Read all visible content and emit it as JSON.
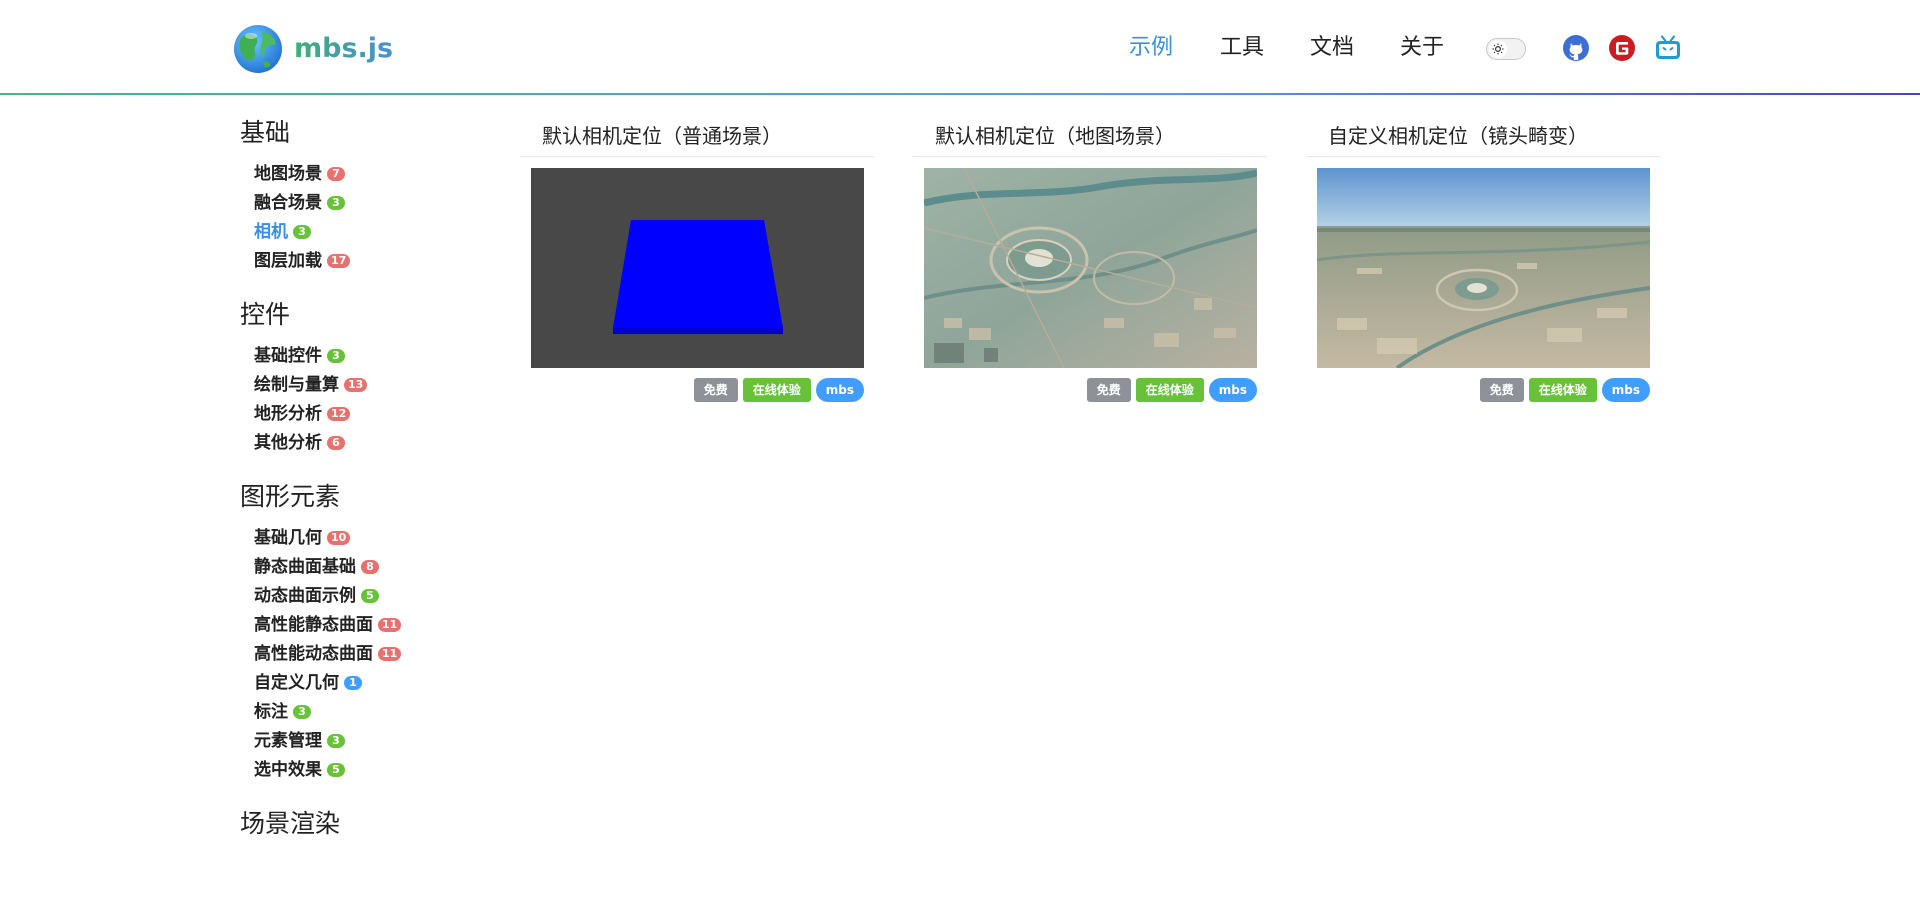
{
  "header": {
    "logo_text": "mbs.js",
    "nav": [
      {
        "label": "示例",
        "active": true
      },
      {
        "label": "工具",
        "active": false
      },
      {
        "label": "文档",
        "active": false
      },
      {
        "label": "关于",
        "active": false
      }
    ],
    "icons": [
      "sun-icon",
      "github-icon",
      "gitee-icon",
      "bilibili-icon"
    ],
    "colors": {
      "accent": "#3a8fe0",
      "brand_green": "#3fae74"
    }
  },
  "sidebar": {
    "groups": [
      {
        "title": "基础",
        "items": [
          {
            "label": "地图场景",
            "count": "7",
            "badge_color": "#e7716e"
          },
          {
            "label": "融合场景",
            "count": "3",
            "badge_color": "#67c23a"
          },
          {
            "label": "相机",
            "count": "3",
            "badge_color": "#67c23a",
            "active": true
          },
          {
            "label": "图层加载",
            "count": "17",
            "badge_color": "#e7716e"
          }
        ]
      },
      {
        "title": "控件",
        "items": [
          {
            "label": "基础控件",
            "count": "3",
            "badge_color": "#67c23a"
          },
          {
            "label": "绘制与量算",
            "count": "13",
            "badge_color": "#e7716e"
          },
          {
            "label": "地形分析",
            "count": "12",
            "badge_color": "#e7716e"
          },
          {
            "label": "其他分析",
            "count": "6",
            "badge_color": "#e7716e"
          }
        ]
      },
      {
        "title": "图形元素",
        "items": [
          {
            "label": "基础几何",
            "count": "10",
            "badge_color": "#e7716e"
          },
          {
            "label": "静态曲面基础",
            "count": "8",
            "badge_color": "#e7716e"
          },
          {
            "label": "动态曲面示例",
            "count": "5",
            "badge_color": "#67c23a"
          },
          {
            "label": "高性能静态曲面",
            "count": "11",
            "badge_color": "#e7716e"
          },
          {
            "label": "高性能动态曲面",
            "count": "11",
            "badge_color": "#e7716e"
          },
          {
            "label": "自定义几何",
            "count": "1",
            "badge_color": "#409eff"
          },
          {
            "label": "标注",
            "count": "3",
            "badge_color": "#67c23a"
          },
          {
            "label": "元素管理",
            "count": "3",
            "badge_color": "#67c23a"
          },
          {
            "label": "选中效果",
            "count": "5",
            "badge_color": "#67c23a"
          }
        ]
      },
      {
        "title": "场景渲染",
        "items": []
      }
    ]
  },
  "cards": [
    {
      "title": "默认相机定位（普通场景）",
      "thumb": "blue-box-scene",
      "tags": {
        "free": "免费",
        "online": "在线体验",
        "lib": "mbs"
      }
    },
    {
      "title": "默认相机定位（地图场景）",
      "thumb": "aerial-topdown",
      "tags": {
        "free": "免费",
        "online": "在线体验",
        "lib": "mbs"
      }
    },
    {
      "title": "自定义相机定位（镜头畸变）",
      "thumb": "aerial-horizon",
      "tags": {
        "free": "免费",
        "online": "在线体验",
        "lib": "mbs"
      }
    }
  ],
  "tag_colors": {
    "free": "#8e9197",
    "online": "#67c23a",
    "lib": "#409eff"
  }
}
